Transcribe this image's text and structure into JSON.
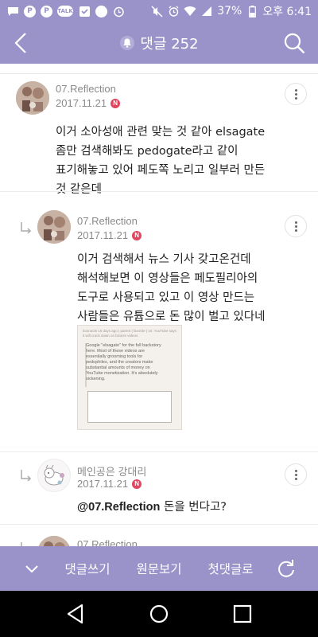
{
  "status_bar": {
    "talk_label": "TALK",
    "battery": "37%",
    "time": "오후 6:41"
  },
  "header": {
    "title": "댓글 252"
  },
  "comments": [
    {
      "author": "07.Reflection",
      "date": "2017.11.21",
      "badge": "N",
      "text": "이거 소아성애 관련 맞는 것 같아 elsagate\n좀만 검색해봐도 pedogate라고 같이\n표기해놓고 있어 페도쪽 노리고 일부러 만든\n것 같은데"
    },
    {
      "author": "07.Reflection",
      "date": "2017.11.21",
      "badge": "N",
      "text": "이거 검색해서 뉴스 기사 갖고온건데\n해석해보면 이 영상들은 페도필리아의\n도구로 사용되고 있고 이 영상 만드는\n사람들은 유튭으로 돈 많이 벌고 있다네",
      "attachment": {
        "header": "bosnaci6 10 days ago | parent | favorite | on: YouTube says it will crack down on bizarre videos",
        "text": "Google \"elsagate\" for the full backstory\nhere. Most of these videos are\nessentially grooming tools for\npedophiles, and the creators make\nsubstantial amounts of money on\nYouTube monetization. It's absolutely\nsickening."
      }
    },
    {
      "author": "메인공은 강대리",
      "date": "2017.11.21",
      "badge": "N",
      "mention": "@07.Reflection",
      "text": " 돈을 번다고?"
    },
    {
      "author": "07.Reflection"
    }
  ],
  "bottom_bar": {
    "write_label": "댓글쓰기",
    "original_label": "원문보기",
    "first_label": "첫댓글로"
  },
  "colors": {
    "accent": "#9a93c9",
    "new_badge": "#e0465d"
  }
}
